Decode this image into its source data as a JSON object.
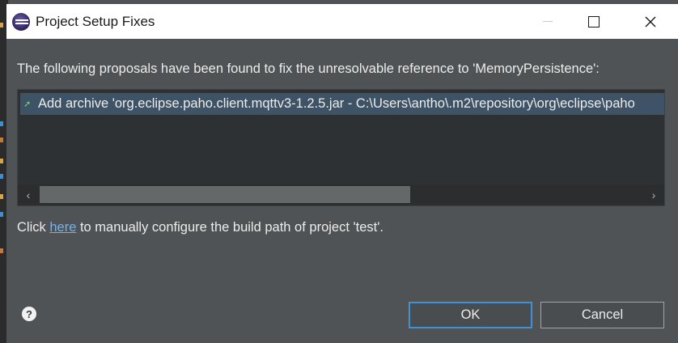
{
  "window": {
    "title": "Project Setup Fixes",
    "controls": {
      "minimize": "minimize",
      "maximize": "maximize",
      "close": "close"
    }
  },
  "dialog": {
    "message": "The following proposals have been found to fix the unresolvable reference to 'MemoryPersistence':",
    "proposals": [
      {
        "label": "Add archive 'org.eclipse.paho.client.mqttv3-1.2.5.jar - C:\\Users\\antho\\.m2\\repository\\org\\eclipse\\paho",
        "selected": true
      }
    ],
    "config_text_before": "Click ",
    "config_link": "here",
    "config_text_after": " to manually configure the build path of project 'test'."
  },
  "buttons": {
    "ok": "OK",
    "cancel": "Cancel"
  },
  "icons": {
    "app": "eclipse-icon",
    "proposal": "add-archive-icon",
    "help": "help-icon",
    "scroll_left": "chevron-left-icon",
    "scroll_right": "chevron-right-icon",
    "close_glyph": "✕",
    "help_glyph": "?",
    "left_glyph": "‹",
    "right_glyph": "›",
    "proposal_glyph": "➚"
  },
  "colors": {
    "dialog_bg": "#505355",
    "list_bg": "#2e3134",
    "selection_bg": "#3e5365",
    "link": "#6fb3f0",
    "default_button_border": "#3f92d6"
  }
}
